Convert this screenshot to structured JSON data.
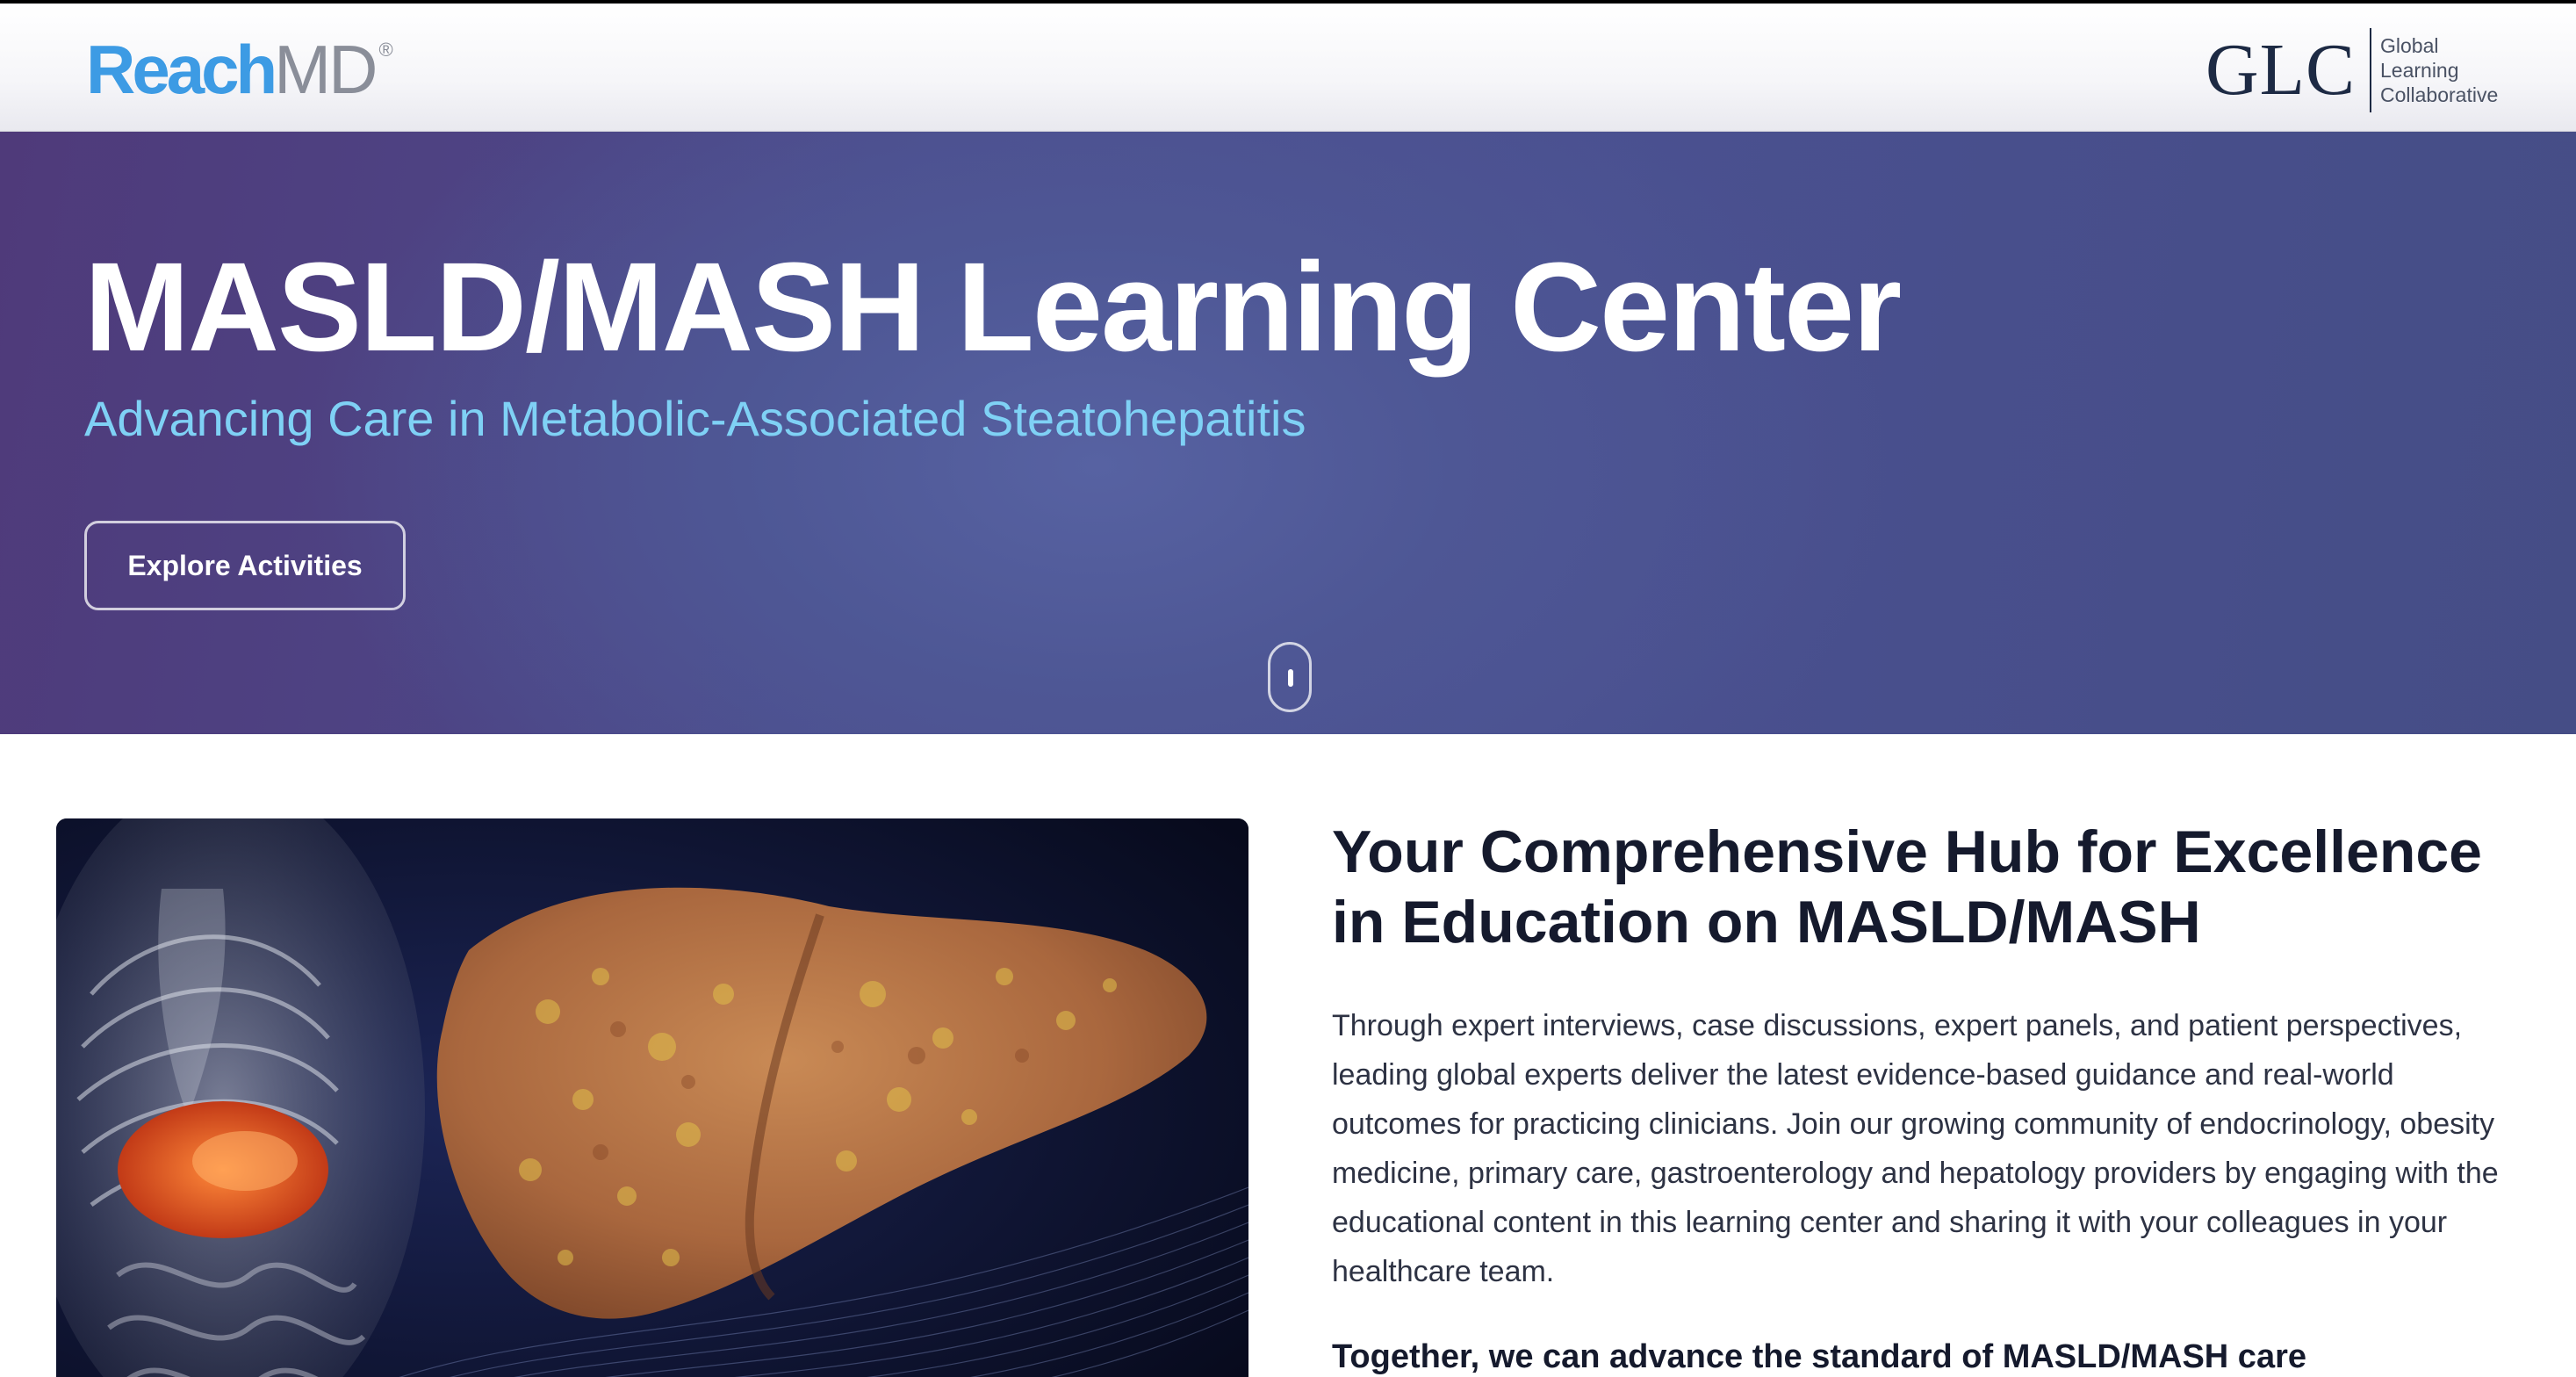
{
  "header": {
    "brand_left": {
      "part1": "Reach",
      "part2": "MD",
      "mark": "®"
    },
    "brand_right": {
      "abbr": "GLC",
      "line1": "Global",
      "line2": "Learning",
      "line3": "Collaborative"
    }
  },
  "hero": {
    "title": "MASLD/MASH Learning Center",
    "subtitle": "Advancing Care in Metabolic-Associated Steatohepatitis",
    "cta_label": "Explore Activities",
    "scroll_icon": "mouse-scroll-icon"
  },
  "main": {
    "heading": "Your Comprehensive Hub for Excellence in Education on MASLD/MASH",
    "body": "Through expert interviews, case discussions, expert panels, and patient perspectives, leading global experts deliver the latest evidence-based guidance and real-world outcomes for practicing clinicians. Join our growing community of endocrinology, obesity medicine, primary care, gastroenterology and hepatology providers by engaging with the educational content in this learning center and sharing it with your colleagues in your healthcare team.",
    "tagline": "Together, we can advance the standard of MASLD/MASH care"
  },
  "colors": {
    "brand_blue": "#3d9be4",
    "brand_gray": "#8a8e99",
    "glc_navy": "#1d2a44",
    "hero_subtitle": "#7fd1f5",
    "heading_text": "#151a2d"
  }
}
